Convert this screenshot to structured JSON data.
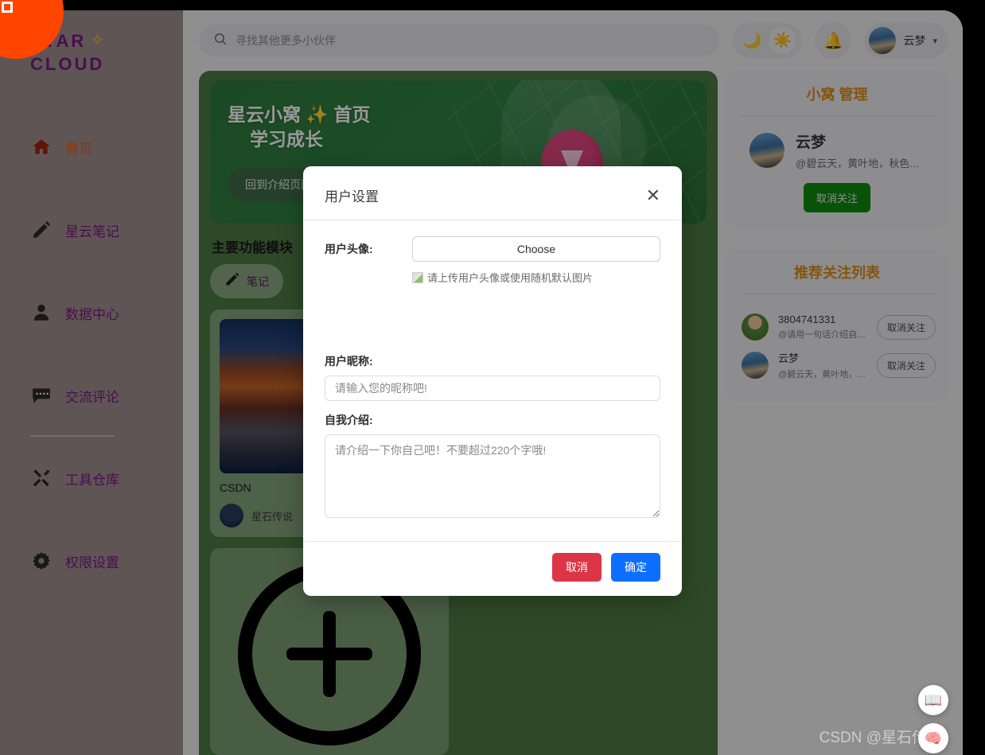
{
  "brand": {
    "line1": "STAR",
    "line2": "CLOUD",
    "swirl_icon": "comet-swirl-icon"
  },
  "sidebar": {
    "items": [
      {
        "label": "首页",
        "icon": "home-icon",
        "active": true
      },
      {
        "label": "星云笔记",
        "icon": "pencil-icon",
        "active": false
      },
      {
        "label": "数据中心",
        "icon": "person-icon",
        "active": false
      },
      {
        "label": "交流评论",
        "icon": "comment-icon",
        "active": false
      },
      {
        "label": "工具仓库",
        "icon": "tools-icon",
        "active": false
      },
      {
        "label": "权限设置",
        "icon": "gear-icon",
        "active": false
      }
    ]
  },
  "topbar": {
    "search_placeholder": "寻找其他更多小伙伴",
    "search_value": "",
    "search_icon": "search-icon",
    "moon_icon": "moon-icon",
    "sun_icon": "sun-icon",
    "bell_icon": "bell-icon",
    "user_name": "云梦",
    "caret_icon": "chevron-down-icon"
  },
  "hero": {
    "title_line1": "星云小窝 ✨ 首页",
    "title_line2": "学习成长",
    "button_label": "回到介绍页面"
  },
  "main": {
    "section_title": "主要功能模块",
    "chips": [
      {
        "label": "笔记",
        "icon": "pencil-icon"
      }
    ],
    "cards": [
      {
        "title": "CSDN",
        "author": "星石传说"
      }
    ],
    "add_card_icon": "plus-circle-icon"
  },
  "rail": {
    "manage_panel": {
      "title": "小窝 管理",
      "owner_name": "云梦",
      "owner_bio": "@碧云天，黄叶地，秋色…",
      "follow_button": "取消关注"
    },
    "recommend_panel": {
      "title": "推荐关注列表",
      "items": [
        {
          "name": "3804741331",
          "bio": "@请用一句话介绍自己吧!",
          "button": "取消关注"
        },
        {
          "name": "云梦",
          "bio": "@碧云天，黄叶地，秋色…",
          "button": "取消关注"
        }
      ]
    }
  },
  "fabs": {
    "book_icon": "book-icon",
    "brain_icon": "brain-icon"
  },
  "watermark": "CSDN @星石传说",
  "modal": {
    "title": "用户设置",
    "close_icon": "close-icon",
    "avatar_label": "用户头像:",
    "choose_button": "Choose",
    "avatar_hint": "请上传用户头像或使用随机默认图片",
    "broken_image_icon": "broken-image-icon",
    "nickname_label": "用户昵称:",
    "nickname_placeholder": "请输入您的昵称吧!",
    "nickname_value": "",
    "bio_label": "自我介绍:",
    "bio_placeholder": "请介绍一下你自己吧！不要超过220个字哦!",
    "bio_value": "",
    "cancel_button": "取消",
    "confirm_button": "确定"
  },
  "colors": {
    "sidebar_bg": "#7a6d6d",
    "brand_purple": "#5c1464",
    "active_orange": "#b3450e",
    "main_green": "#4e7a42",
    "panel_title_orange": "#e08c12",
    "cancel_red": "#dc3545",
    "confirm_blue": "#0d6efd",
    "follow_green": "#0f8a0f",
    "corner_orange": "#ff4500"
  }
}
